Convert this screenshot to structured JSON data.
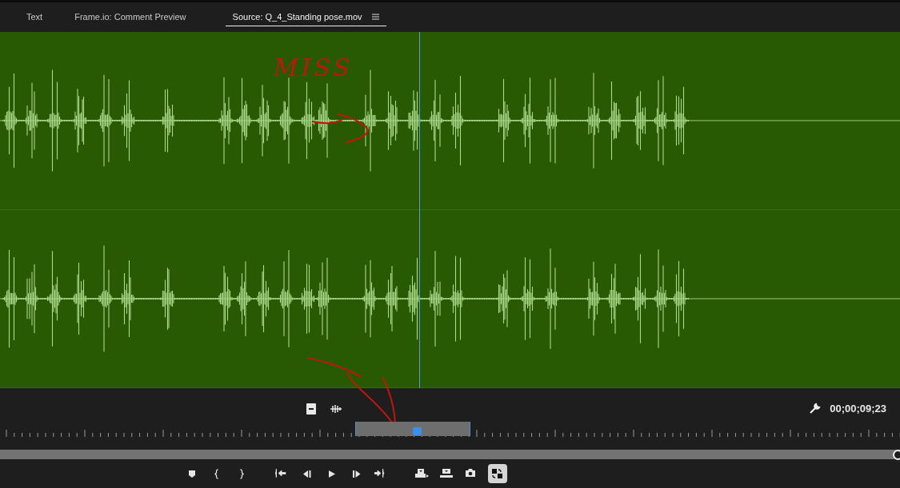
{
  "tabs": [
    {
      "label": "Text",
      "selected": false
    },
    {
      "label": "Frame.io: Comment Preview",
      "selected": false
    },
    {
      "label": "Source: Q_4_Standing pose.mov",
      "selected": true
    }
  ],
  "annotation": {
    "text": "MISS"
  },
  "timecode": "00;00;09;23",
  "transport": [
    {
      "kind": "marker",
      "on": false
    },
    {
      "kind": "mark-in",
      "on": false
    },
    {
      "kind": "mark-out",
      "on": false
    },
    {
      "kind": "go-in",
      "on": false
    },
    {
      "kind": "step-back",
      "on": false
    },
    {
      "kind": "play",
      "on": false
    },
    {
      "kind": "step-forward",
      "on": false
    },
    {
      "kind": "go-out",
      "on": false
    },
    {
      "kind": "insert",
      "on": false
    },
    {
      "kind": "overwrite",
      "on": false
    },
    {
      "kind": "export-frame",
      "on": false
    },
    {
      "kind": "compare",
      "on": true
    }
  ]
}
